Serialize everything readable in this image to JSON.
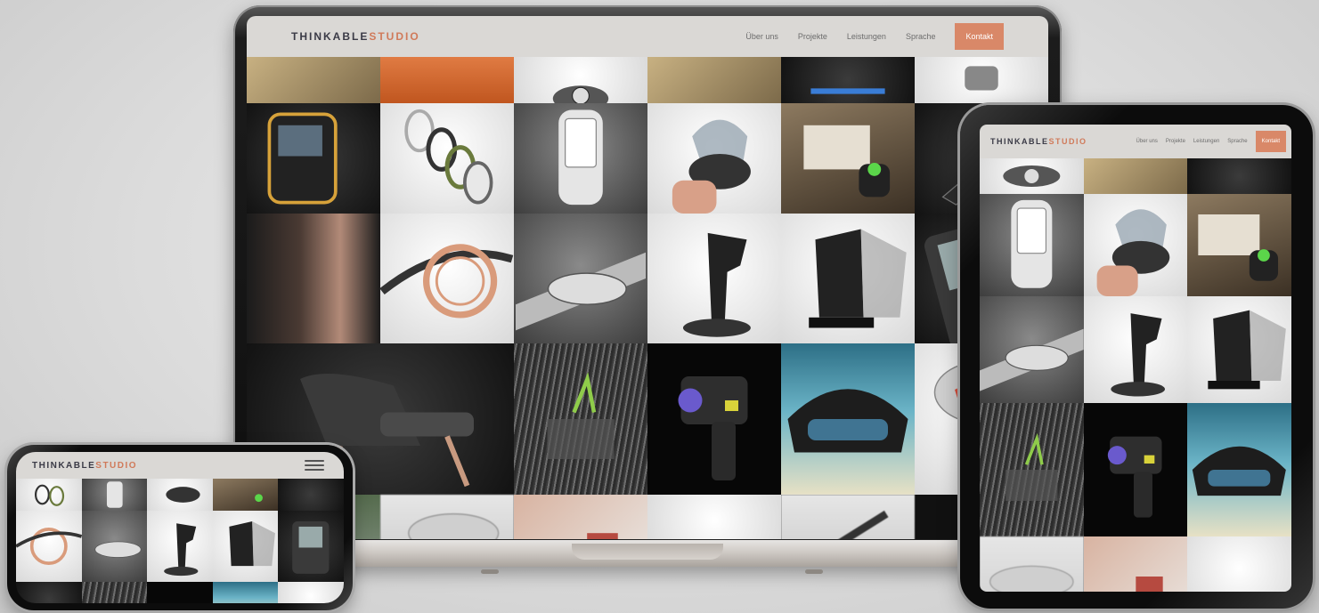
{
  "site": {
    "logo_part1": "THINKABLE",
    "logo_part2": "STUDIO",
    "nav": {
      "about": "Über uns",
      "projects": "Projekte",
      "services": "Leistungen",
      "language": "Sprache",
      "contact": "Kontakt"
    }
  },
  "colors": {
    "accent": "#d98868",
    "logo_dark": "#3a3a46",
    "logo_accent": "#d07a5a",
    "nav_bar": "#ece9e6"
  },
  "icons": {
    "mobile_menu": "hamburger-icon"
  }
}
